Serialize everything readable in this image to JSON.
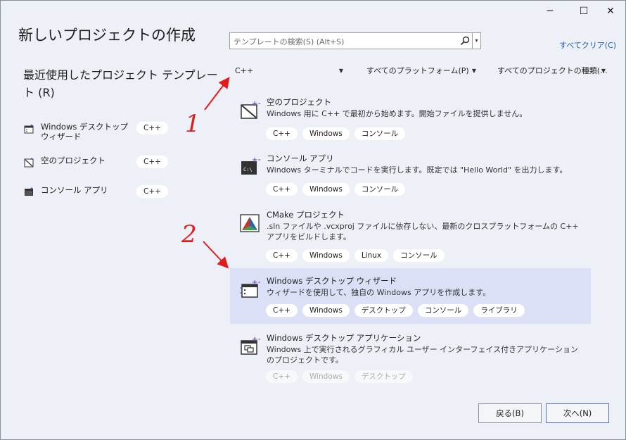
{
  "window": {
    "title": "新しいプロジェクトの作成",
    "controls": {
      "minimize": "─",
      "maximize": "☐",
      "close": "✕"
    }
  },
  "recent": {
    "title": "最近使用したプロジェクト テンプレート (R)",
    "items": [
      {
        "label": "Windows デスクトップ ウィザード",
        "tag": "C++"
      },
      {
        "label": "空のプロジェクト",
        "tag": "C++"
      },
      {
        "label": "コンソール アプリ",
        "tag": "C++"
      }
    ]
  },
  "search": {
    "placeholder": "テンプレートの検索(S) (Alt+S)",
    "clear_label": "すべてクリア(C)"
  },
  "filters": {
    "language": "C++",
    "platform": "すべてのプラットフォーム(P)",
    "project_type": "すべてのプロジェクトの種類(..."
  },
  "templates": [
    {
      "name": "空のプロジェクト",
      "desc": "Windows 用に C++ で最初から始めます。開始ファイルを提供しません。",
      "tags": [
        "C++",
        "Windows",
        "コンソール"
      ]
    },
    {
      "name": "コンソール アプリ",
      "desc": "Windows ターミナルでコードを実行します。既定では \"Hello World\" を出力します。",
      "tags": [
        "C++",
        "Windows",
        "コンソール"
      ]
    },
    {
      "name": "CMake プロジェクト",
      "desc": ".sln ファイルや .vcxproj ファイルに依存しない、最新のクロスプラットフォームの C++ アプリをビルドします。",
      "tags": [
        "C++",
        "Windows",
        "Linux",
        "コンソール"
      ]
    },
    {
      "name": "Windows デスクトップ ウィザード",
      "desc": "ウィザードを使用して、独自の Windows アプリを作成します。",
      "tags": [
        "C++",
        "Windows",
        "デスクトップ",
        "コンソール",
        "ライブラリ"
      ]
    },
    {
      "name": "Windows デスクトップ アプリケーション",
      "desc": "Windows 上で実行されるグラフィカル ユーザー インターフェイス付きアプリケーションのプロジェクトです。",
      "tags": [
        "C++",
        "Windows",
        "デスクトップ"
      ]
    }
  ],
  "annotations": {
    "one": "1",
    "two": "2",
    "color": "#e31b1b"
  },
  "buttons": {
    "back": "戻る(B)",
    "next": "次へ(N)"
  }
}
